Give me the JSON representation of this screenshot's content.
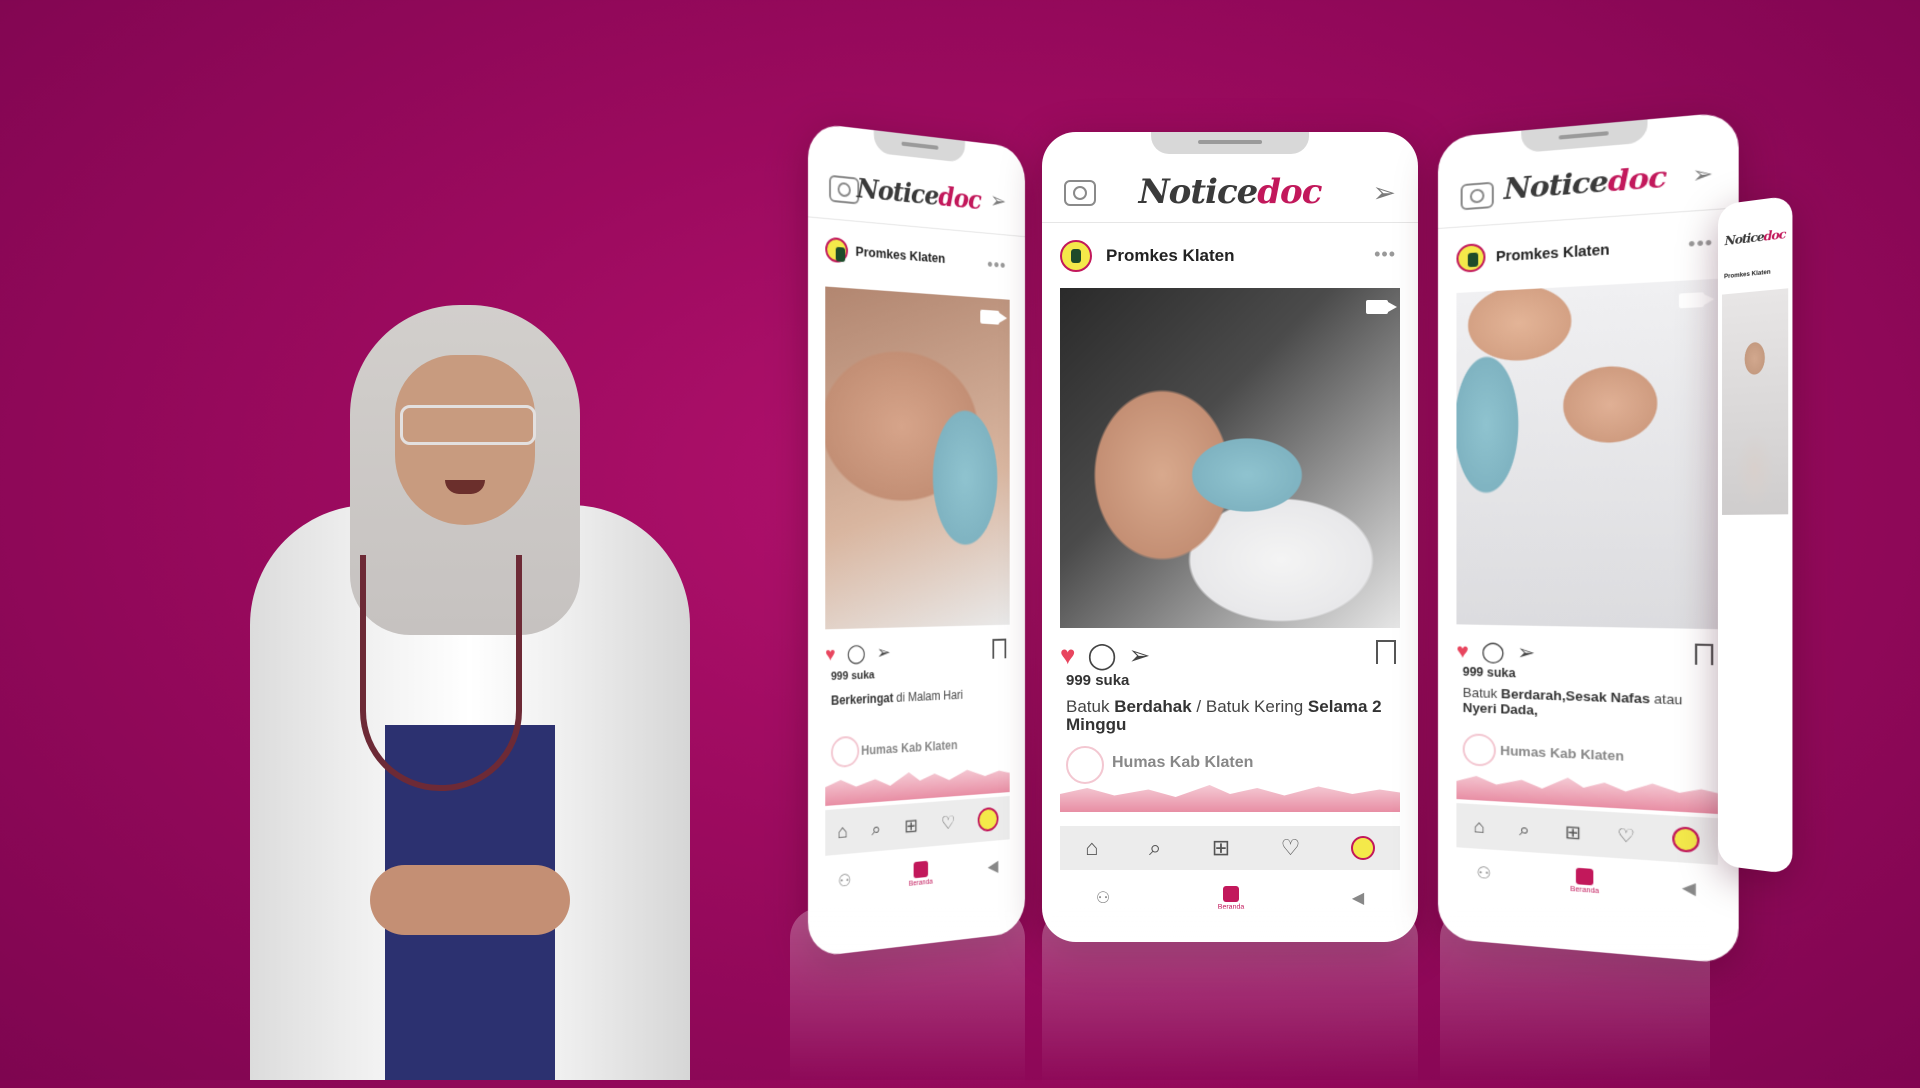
{
  "app": {
    "logo_prefix": "Notice",
    "logo_accent": "doc",
    "brand_color": "#c2185b",
    "background_color": "#9b0a5e"
  },
  "phones": {
    "left": {
      "account": "Promkes Klaten",
      "likes": "999 suka",
      "caption_bold": "Berkeringat",
      "caption_rest": " di Malam Hari",
      "footer_account": "Humas Kab Klaten",
      "nav_label": "Beranda"
    },
    "center": {
      "account": "Promkes Klaten",
      "likes": "999 suka",
      "caption_p1": "Batuk ",
      "caption_b1": "Berdahak",
      "caption_p2": " / Batuk Kering ",
      "caption_b2": "Selama 2 Minggu",
      "footer_account": "Humas Kab Klaten",
      "nav_label": "Beranda"
    },
    "right": {
      "account": "Promkes Klaten",
      "likes": "999 suka",
      "caption_p1": "Batuk ",
      "caption_b1": "Berdarah,Sesak Nafas",
      "caption_p2": " atau ",
      "caption_b2": "Nyeri Dada,",
      "footer_account": "Humas Kab Klaten",
      "nav_label": "Beranda"
    },
    "far": {
      "account": "Promkes Klaten"
    }
  },
  "icons": {
    "camera": "camera-icon",
    "send": "send-icon",
    "more": "more-icon",
    "video": "video-icon",
    "like": "heart-icon",
    "comment": "comment-icon",
    "share": "share-icon",
    "save": "bookmark-icon",
    "home": "home-icon",
    "search": "search-icon",
    "add": "add-icon",
    "activity": "heart-outline-icon",
    "profile": "profile-icon",
    "back": "back-icon",
    "user": "user-icon"
  }
}
